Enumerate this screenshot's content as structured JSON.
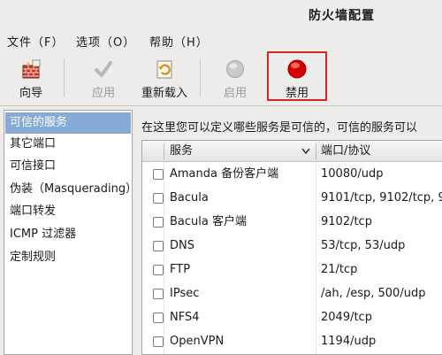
{
  "window": {
    "title": "防火墙配置"
  },
  "menu": [
    "文件（F）",
    "选项（O）",
    "帮助（H）"
  ],
  "toolbar": {
    "wizard": "向导",
    "apply": "应用",
    "reload": "重新载入",
    "enable": "启用",
    "disable": "禁用"
  },
  "sidebar": {
    "items": [
      "可信的服务",
      "其它端口",
      "可信接口",
      "伪装（Masquerading）",
      "端口转发",
      "ICMP 过滤器",
      "定制规则"
    ],
    "selected_index": 0
  },
  "main": {
    "description": "在这里您可以定义哪些服务是可信的，可信的服务可以",
    "columns": {
      "service": "服务",
      "port": "端口/协议"
    },
    "rows": [
      {
        "service": "Amanda 备份客户端",
        "port": "10080/udp",
        "checked": false
      },
      {
        "service": "Bacula",
        "port": "9101/tcp, 9102/tcp, 9",
        "checked": false
      },
      {
        "service": "Bacula 客户端",
        "port": "9102/tcp",
        "checked": false
      },
      {
        "service": "DNS",
        "port": "53/tcp, 53/udp",
        "checked": false
      },
      {
        "service": "FTP",
        "port": "21/tcp",
        "checked": false
      },
      {
        "service": "IPsec",
        "port": "/ah, /esp, 500/udp",
        "checked": false
      },
      {
        "service": "NFS4",
        "port": "2049/tcp",
        "checked": false
      },
      {
        "service": "OpenVPN",
        "port": "1194/udp",
        "checked": false
      }
    ]
  },
  "colors": {
    "selection": "#86abd9",
    "highlight_box": "#d9232b",
    "disabled_button": "#d40000"
  }
}
